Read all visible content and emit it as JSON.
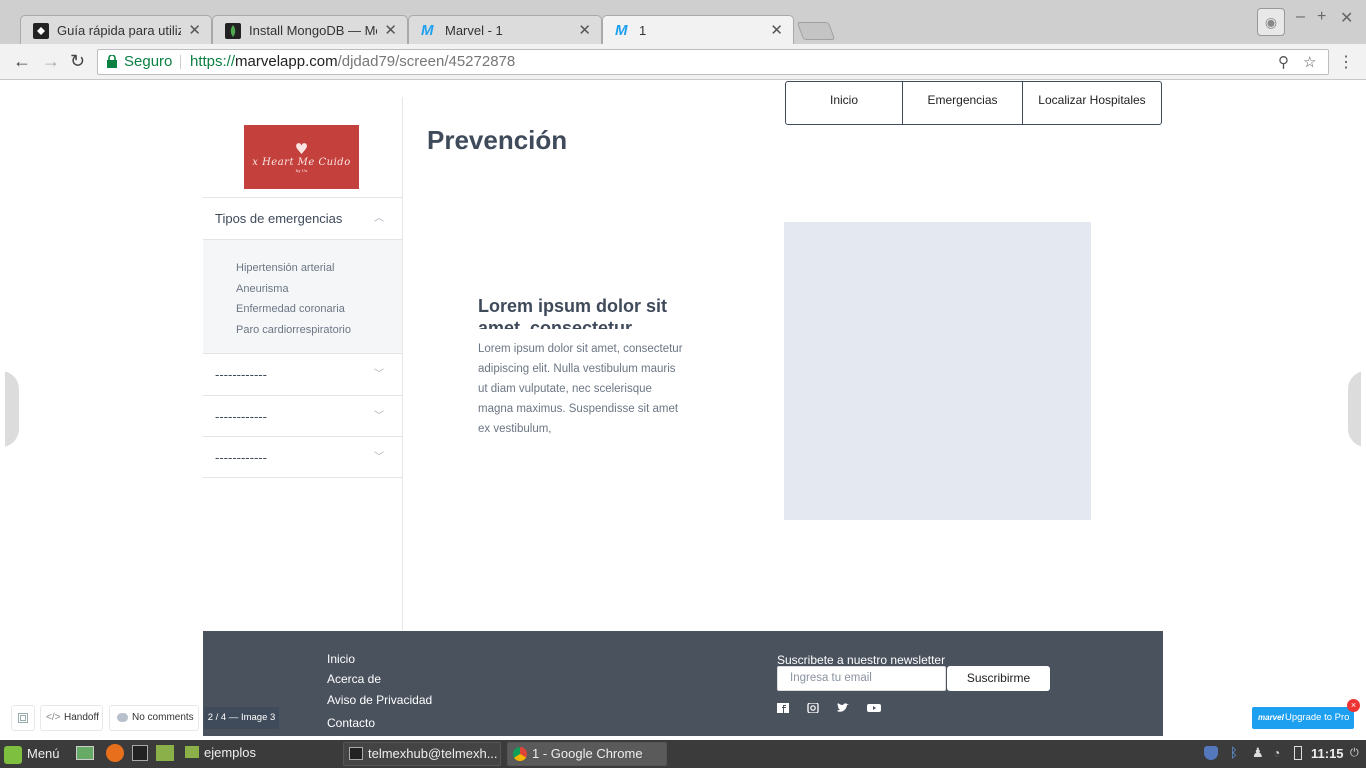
{
  "browser": {
    "tabs": [
      {
        "title": "Guía rápida para utilizar",
        "icon": "github-icon"
      },
      {
        "title": "Install MongoDB — Mon",
        "icon": "mongodb-leaf-icon"
      },
      {
        "title": "Marvel - 1",
        "icon": "marvel-icon"
      },
      {
        "title": "1",
        "icon": "marvel-icon"
      }
    ],
    "secure_label": "Seguro",
    "url_scheme": "https://",
    "url_host": "marvelapp.com",
    "url_path": "/djdad79/screen/45272878"
  },
  "page": {
    "logo": {
      "brand": "x Heart Me Cuido",
      "tagline": "by Ux"
    },
    "sidebar": {
      "section_open": "Tipos de emergencias",
      "items": [
        "Hipertensión arterial",
        "Aneurisma",
        "Enfermedad coronaria",
        "Paro cardiorrespiratorio"
      ],
      "collapsed": [
        "------------",
        "------------",
        "------------"
      ]
    },
    "title": "Prevención",
    "topnav": [
      "Inicio",
      "Emergencias",
      "Localizar Hospitales"
    ],
    "card": {
      "title": "Lorem ipsum dolor sit amet, consectetur",
      "body": "Lorem ipsum dolor sit amet, consectetur adipiscing elit. Nulla vestibulum mauris ut diam vulputate, nec scelerisque magna maximus. Suspendisse sit amet ex vestibulum,"
    },
    "footer": {
      "links": [
        "Inicio",
        "Acerca de",
        "Aviso de Privacidad",
        "Contacto"
      ],
      "newsletter_label": "Suscribete a nuestro  newsletter",
      "email_placeholder": "Ingresa tu email",
      "subscribe_label": "Suscribirme",
      "social": [
        "facebook-icon",
        "instagram-icon",
        "twitter-icon",
        "youtube-icon"
      ]
    }
  },
  "marvel": {
    "handoff": "Handoff",
    "comments": "No comments",
    "counter": "2 / 4 — Image 3",
    "upgrade": "Upgrade to Pro",
    "logo_text": "marvel"
  },
  "taskbar": {
    "menu": "Menú",
    "windows": [
      "ejemplos",
      "telmexhub@telmexh...",
      "1 - Google Chrome"
    ],
    "clock": "11:15"
  },
  "colors": {
    "primary_text": "#3f4a5a",
    "logo_bg": "#c4403c",
    "footer_bg": "#4a525e",
    "marvel_blue": "#1ea0f1"
  }
}
